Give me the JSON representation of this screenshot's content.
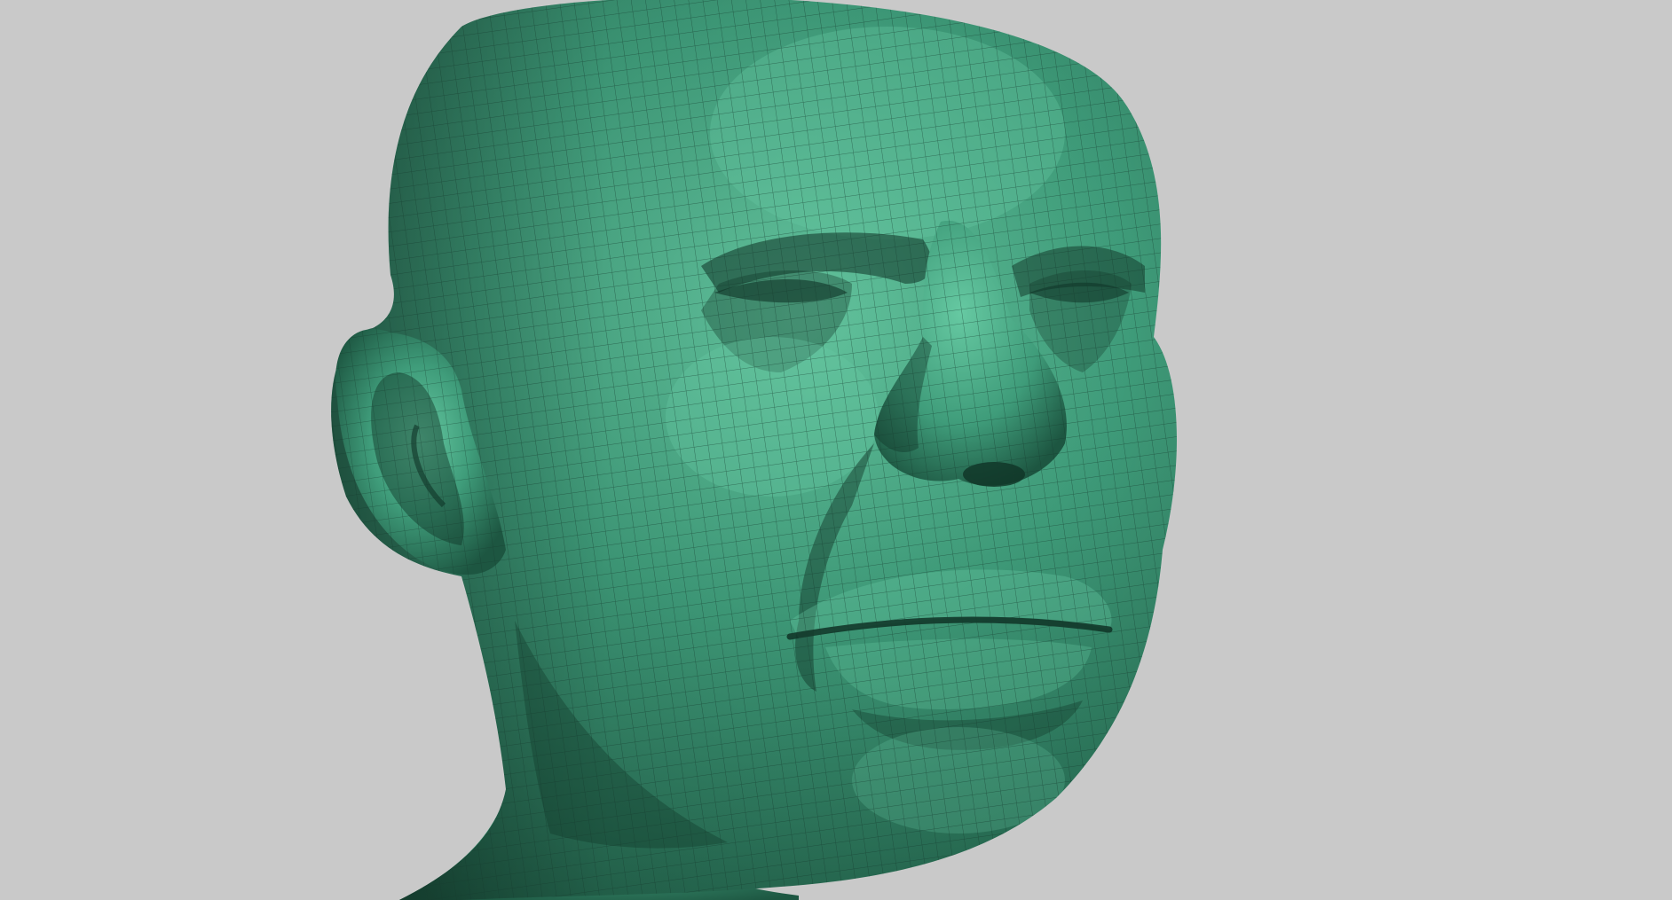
{
  "viewport": {
    "background_color": "#c9c9c9",
    "subject": "head-sculpt-mesh",
    "render_mode": "shaded-with-wireframe",
    "colors": {
      "material_base": "#3f9c7a",
      "material_light": "#66c9a2",
      "material_dark": "#1d5641",
      "shadow": "#0f3326",
      "wire": "#163b2e"
    }
  }
}
